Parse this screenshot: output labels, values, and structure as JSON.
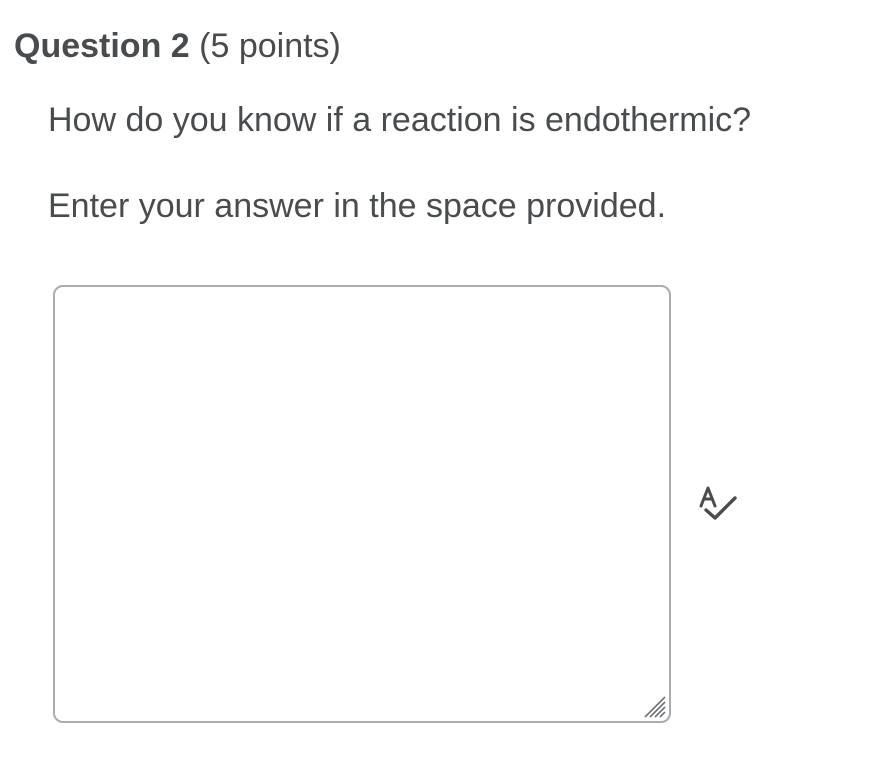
{
  "question": {
    "title": "Question 2",
    "points": "(5 points)",
    "prompt": "How do you know if a reaction is endothermic?",
    "instruction": "Enter your answer in the space provided."
  },
  "answer": {
    "value": ""
  },
  "icons": {
    "spellcheck": "spellcheck-icon",
    "resize": "resize-grip-icon"
  },
  "colors": {
    "text": "#494c4e",
    "border": "#a8adb2"
  }
}
